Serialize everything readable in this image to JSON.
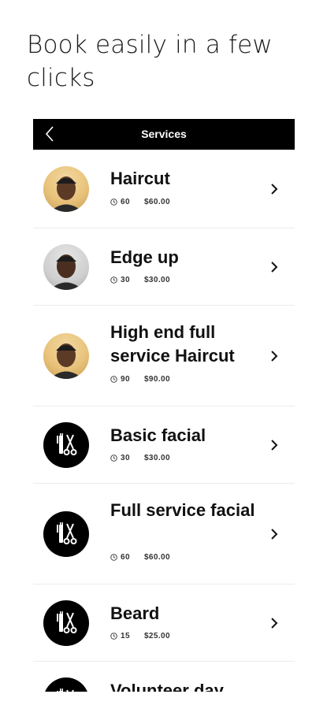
{
  "headline": "Book easily in a few clicks",
  "topbar": {
    "title": "Services",
    "back_icon": "chevron-left-icon"
  },
  "services": [
    {
      "name": "Haircut",
      "duration": "60",
      "price": "$60.00",
      "avatar": "photo"
    },
    {
      "name": "Edge up",
      "duration": "30",
      "price": "$30.00",
      "avatar": "photo2"
    },
    {
      "name": "High end full service Haircut",
      "duration": "90",
      "price": "$90.00",
      "avatar": "photo"
    },
    {
      "name": "Basic facial",
      "duration": "30",
      "price": "$30.00",
      "avatar": "barber-tools-icon"
    },
    {
      "name": "Full service facial",
      "duration": "60",
      "price": "$60.00",
      "avatar": "barber-tools-icon"
    },
    {
      "name": "Beard",
      "duration": "15",
      "price": "$25.00",
      "avatar": "barber-tools-icon"
    },
    {
      "name": "Volunteer day",
      "duration": "",
      "price": "",
      "avatar": "barber-tools-icon"
    }
  ],
  "colors": {
    "topbar_bg": "#000000",
    "topbar_text": "#ffffff",
    "accent": "#000000"
  }
}
